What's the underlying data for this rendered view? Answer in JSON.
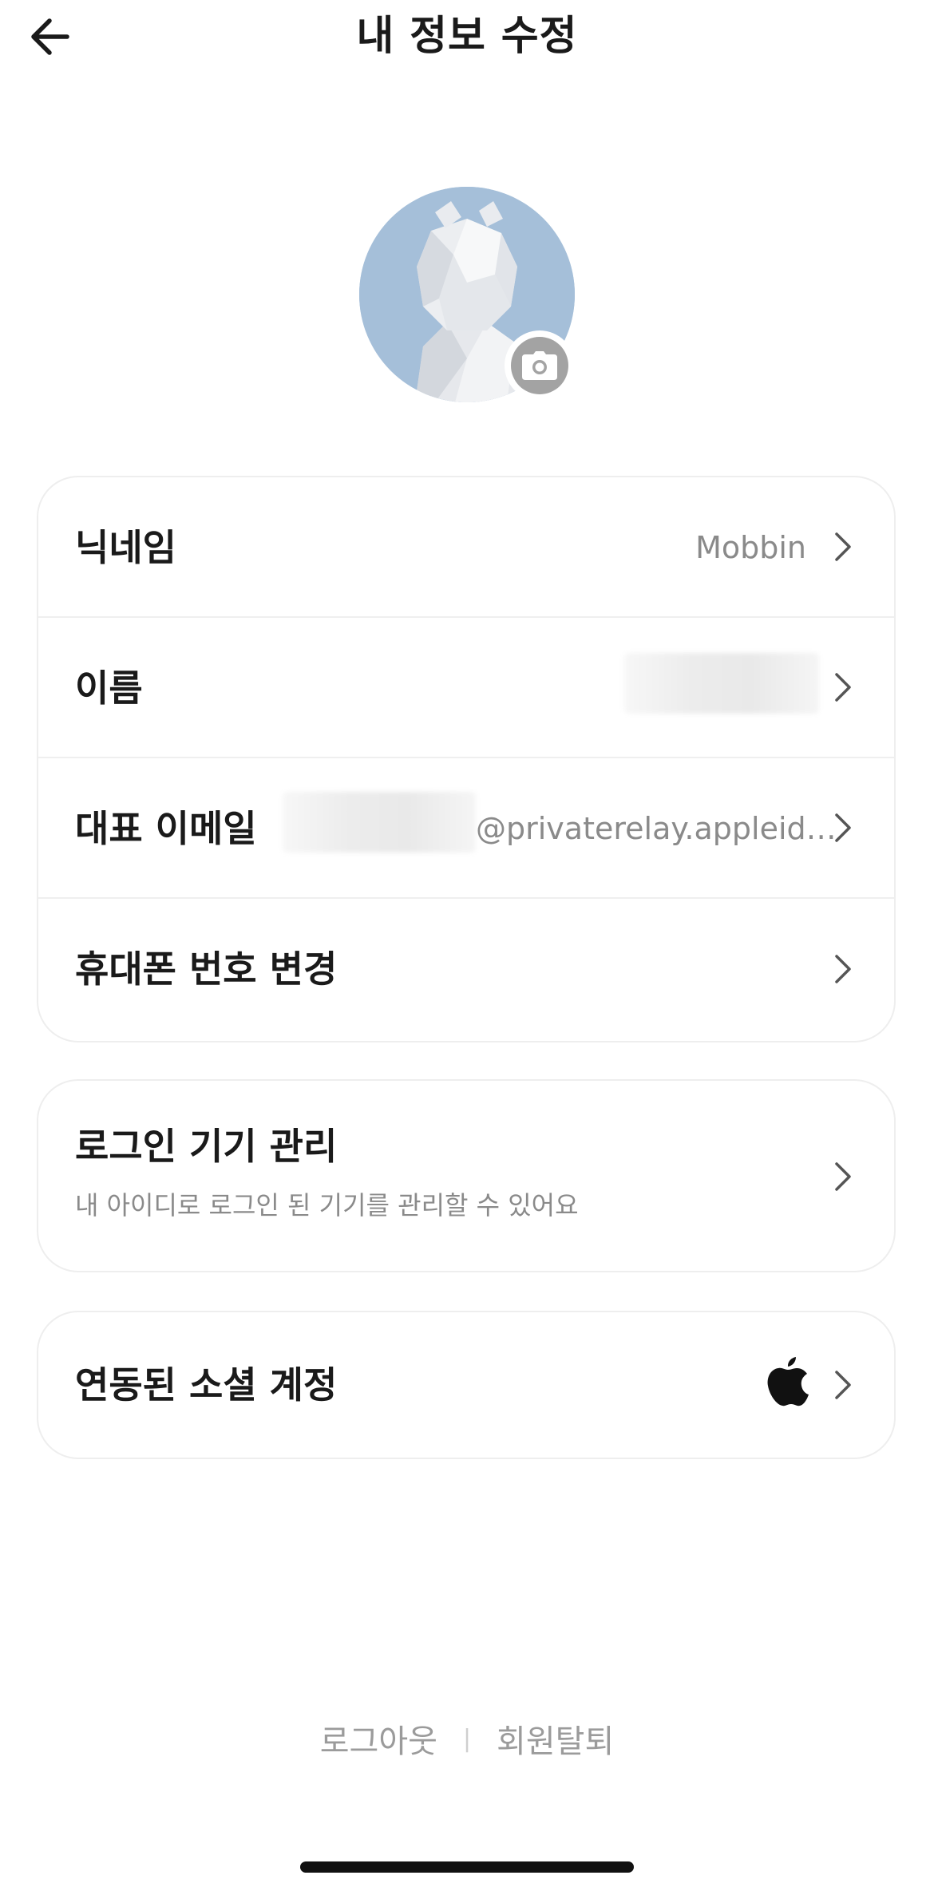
{
  "header": {
    "title": "내 정보 수정",
    "back_icon": "arrow-left-icon"
  },
  "avatar": {
    "camera_icon": "camera-icon",
    "background_color": "#a5bfd9"
  },
  "profile": {
    "rows": [
      {
        "label": "닉네임",
        "value": "Mobbin"
      },
      {
        "label": "이름",
        "value": ""
      },
      {
        "label": "대표 이메일",
        "value": "@privaterelay.appleid…"
      },
      {
        "label": "휴대폰 번호 변경",
        "value": ""
      }
    ]
  },
  "devices": {
    "title": "로그인 기기 관리",
    "description": "내 아이디로 로그인 된 기기를 관리할 수 있어요"
  },
  "social": {
    "label": "연동된 소셜 계정",
    "provider_icon": "apple-icon"
  },
  "footer": {
    "logout": "로그아웃",
    "separator": "|",
    "withdraw": "회원탈퇴"
  },
  "colors": {
    "text_primary": "#1a1a1a",
    "text_secondary": "#8a8a8a",
    "divider": "#efefef"
  }
}
